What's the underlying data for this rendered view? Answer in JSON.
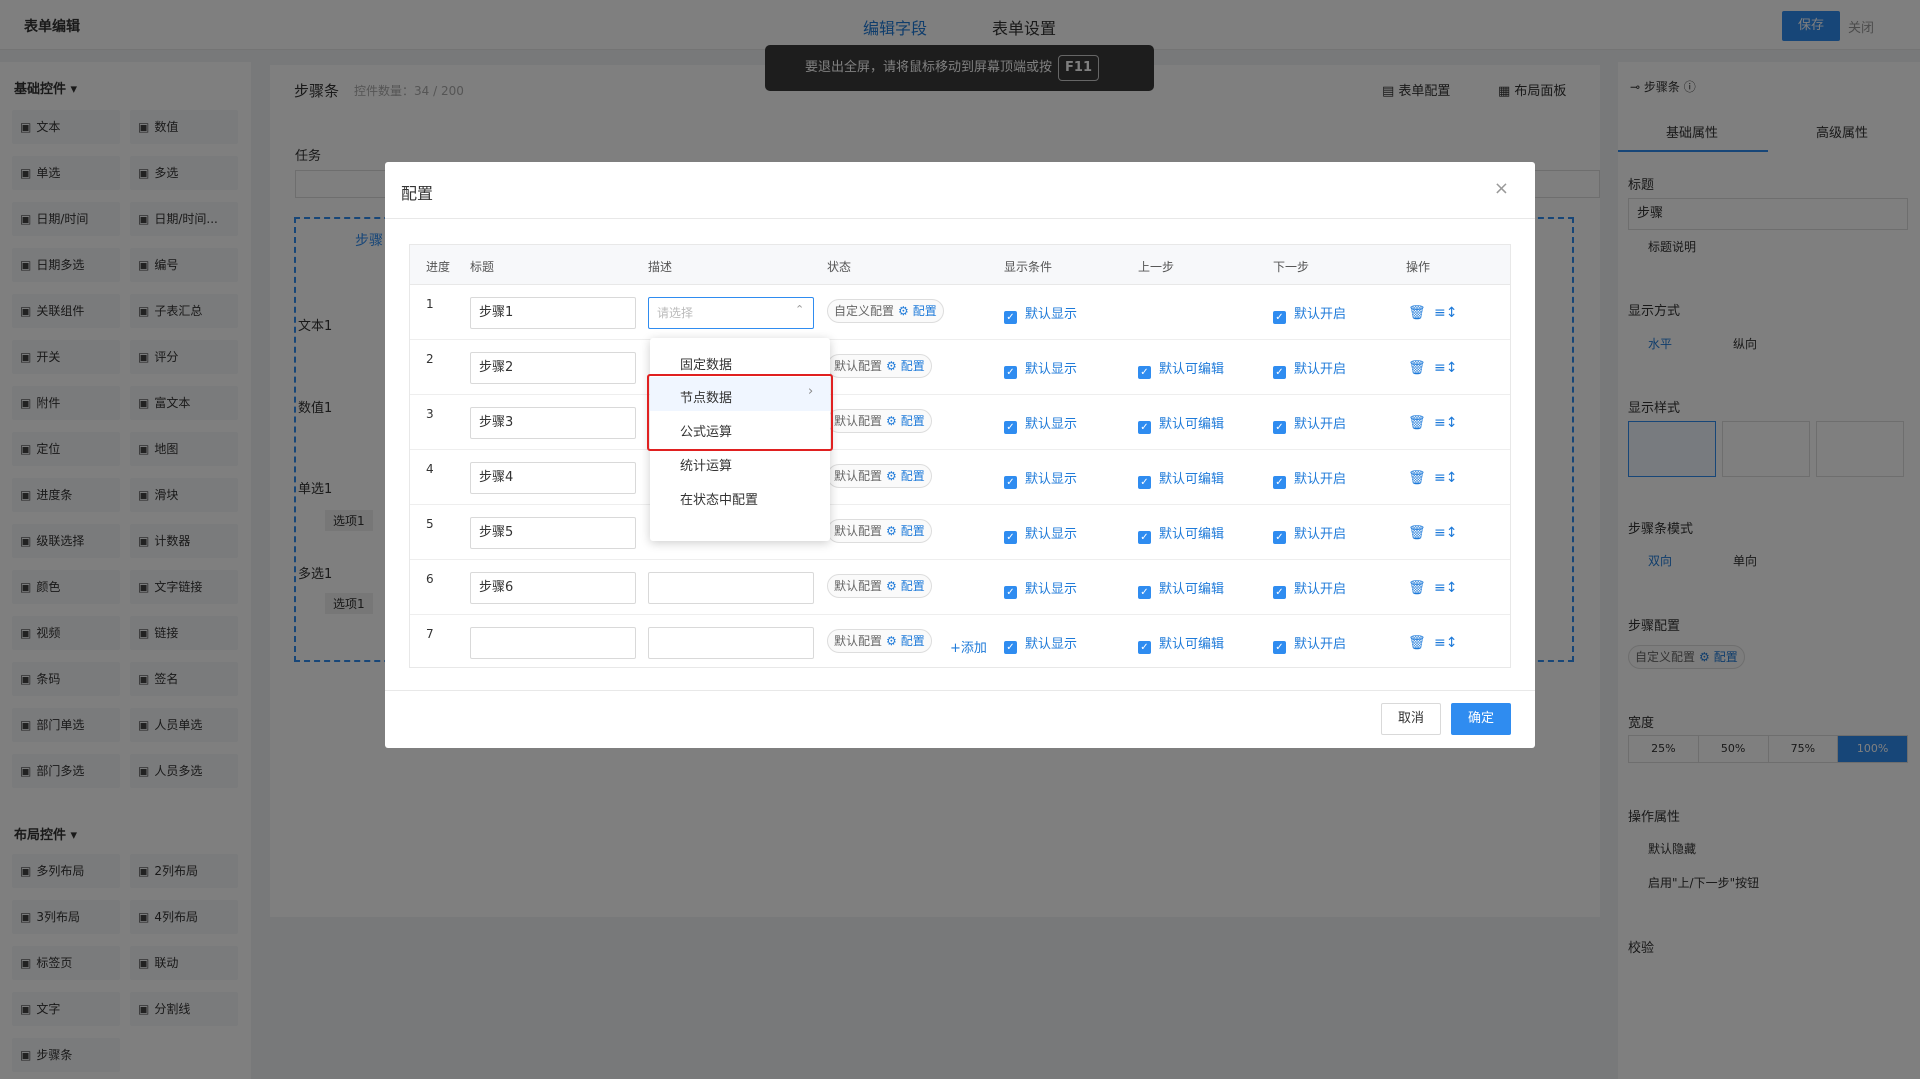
{
  "header": {
    "title": "表单编辑",
    "tabs": [
      "编辑字段",
      "表单设置"
    ],
    "save": "保存",
    "close": "关闭"
  },
  "fullscreen_tip": {
    "text": "要退出全屏，请将鼠标移动到屏幕顶端或按",
    "key": "F11"
  },
  "left": {
    "basic_section": "基础控件",
    "basic": [
      [
        "文本",
        "数值"
      ],
      [
        "单选",
        "多选"
      ],
      [
        "日期/时间",
        "日期/时间..."
      ],
      [
        "日期多选",
        "编号"
      ],
      [
        "关联组件",
        "子表汇总"
      ],
      [
        "开关",
        "评分"
      ],
      [
        "附件",
        "富文本"
      ],
      [
        "定位",
        "地图"
      ],
      [
        "进度条",
        "滑块"
      ],
      [
        "级联选择",
        "计数器"
      ],
      [
        "颜色",
        "文字链接"
      ],
      [
        "视频",
        "链接"
      ],
      [
        "条码",
        "签名"
      ],
      [
        "部门单选",
        "人员单选"
      ],
      [
        "部门多选",
        "人员多选"
      ]
    ],
    "layout_section": "布局控件",
    "layout": [
      [
        "多列布局",
        "2列布局"
      ],
      [
        "3列布局",
        "4列布局"
      ],
      [
        "标签页",
        "联动"
      ],
      [
        "文字",
        "分割线"
      ],
      [
        "步骤条",
        ""
      ]
    ]
  },
  "canvas": {
    "title": "步骤条",
    "count": "控件数量：34 / 200",
    "form_config": "表单配置",
    "layout_panel": "布局面板",
    "task": "任务",
    "step": "步骤",
    "text1": "文本1",
    "num1": "数值1",
    "radio1": "单选1",
    "opt1": "选项1",
    "multi1": "多选1",
    "opt2": "选项1"
  },
  "right": {
    "head": "步骤条",
    "tabs": [
      "基础属性",
      "高级属性"
    ],
    "title_label": "标题",
    "title_value": "步骤",
    "title_desc": "标题说明",
    "display_mode": "显示方式",
    "horizontal": "水平",
    "vertical": "纵向",
    "display_style": "显示样式",
    "mode_label": "步骤条模式",
    "bidir": "双向",
    "unidir": "单向",
    "step_config": "步骤配置",
    "custom_config": "自定义配置",
    "config": "配置",
    "width_label": "宽度",
    "widths": [
      "25%",
      "50%",
      "75%",
      "100%"
    ],
    "op_label": "操作属性",
    "hide_default": "默认隐藏",
    "enable_btn": "启用\"上/下一步\"按钮",
    "validate": "校验"
  },
  "dialog": {
    "title": "配置",
    "close": "×",
    "columns": [
      "进度",
      "标题",
      "描述",
      "状态",
      "显示条件",
      "上一步",
      "下一步",
      "操作"
    ],
    "rows": [
      {
        "n": "1",
        "title": "步骤1",
        "status": "自定义配置",
        "show": "默认显示",
        "prev": "",
        "next": "默认开启"
      },
      {
        "n": "2",
        "title": "步骤2",
        "status": "默认配置",
        "show": "默认显示",
        "prev": "默认可编辑",
        "next": "默认开启"
      },
      {
        "n": "3",
        "title": "步骤3",
        "status": "默认配置",
        "show": "默认显示",
        "prev": "默认可编辑",
        "next": "默认开启"
      },
      {
        "n": "4",
        "title": "步骤4",
        "status": "默认配置",
        "show": "默认显示",
        "prev": "默认可编辑",
        "next": "默认开启"
      },
      {
        "n": "5",
        "title": "步骤5",
        "status": "默认配置",
        "show": "默认显示",
        "prev": "默认可编辑",
        "next": "默认开启"
      },
      {
        "n": "6",
        "title": "步骤6",
        "status": "默认配置",
        "show": "默认显示",
        "prev": "默认可编辑",
        "next": "默认开启"
      },
      {
        "n": "7",
        "title": "",
        "status": "默认配置",
        "show": "默认显示",
        "prev": "默认可编辑",
        "next": "默认开启"
      }
    ],
    "config": "配置",
    "select_placeholder": "请选择",
    "dropdown": [
      "固定数据",
      "节点数据",
      "公式运算",
      "统计运算",
      "在状态中配置"
    ],
    "add": "+添加",
    "cancel": "取消",
    "ok": "确定"
  }
}
